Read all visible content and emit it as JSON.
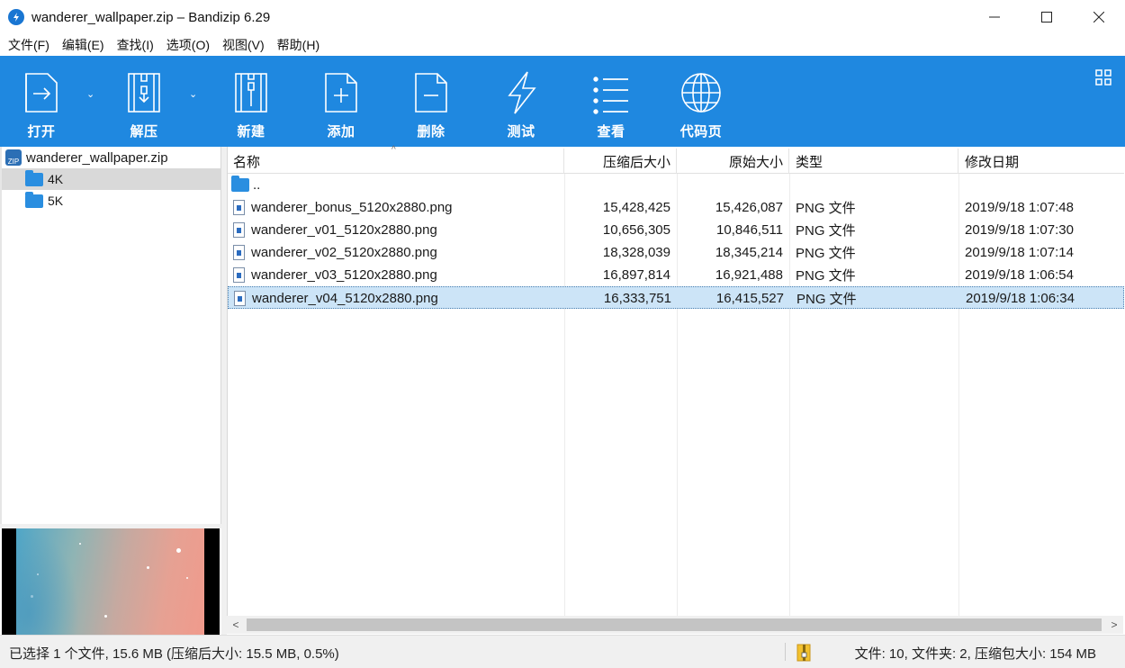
{
  "window": {
    "title": "wanderer_wallpaper.zip – Bandizip 6.29",
    "minimize_icon": "minimize-icon",
    "maximize_icon": "maximize-icon",
    "close_icon": "close-icon"
  },
  "menu": [
    "文件(F)",
    "编辑(E)",
    "查找(I)",
    "选项(O)",
    "视图(V)",
    "帮助(H)"
  ],
  "toolbar": {
    "accent": "#1f88e0",
    "buttons": [
      {
        "label": "打开",
        "icon": "open-icon"
      },
      {
        "label": "解压",
        "icon": "extract-icon"
      },
      {
        "label": "新建",
        "icon": "new-archive-icon"
      },
      {
        "label": "添加",
        "icon": "add-icon"
      },
      {
        "label": "删除",
        "icon": "delete-icon"
      },
      {
        "label": "测试",
        "icon": "test-icon"
      },
      {
        "label": "查看",
        "icon": "view-icon"
      },
      {
        "label": "代码页",
        "icon": "codepage-icon"
      }
    ]
  },
  "tree": {
    "root": "wanderer_wallpaper.zip",
    "zip_badge": "ZIP",
    "folders": [
      "4K",
      "5K"
    ],
    "selected": "4K"
  },
  "list": {
    "columns": [
      "名称",
      "压缩后大小",
      "原始大小",
      "类型",
      "修改日期"
    ],
    "sort_arrow": "^",
    "up_row": "..",
    "rows": [
      {
        "name": "wanderer_bonus_5120x2880.png",
        "packed": "15,428,425",
        "size": "15,426,087",
        "type": "PNG 文件",
        "modified": "2019/9/18 1:07:48"
      },
      {
        "name": "wanderer_v01_5120x2880.png",
        "packed": "10,656,305",
        "size": "10,846,511",
        "type": "PNG 文件",
        "modified": "2019/9/18 1:07:30"
      },
      {
        "name": "wanderer_v02_5120x2880.png",
        "packed": "18,328,039",
        "size": "18,345,214",
        "type": "PNG 文件",
        "modified": "2019/9/18 1:07:14"
      },
      {
        "name": "wanderer_v03_5120x2880.png",
        "packed": "16,897,814",
        "size": "16,921,488",
        "type": "PNG 文件",
        "modified": "2019/9/18 1:06:54"
      },
      {
        "name": "wanderer_v04_5120x2880.png",
        "packed": "16,333,751",
        "size": "16,415,527",
        "type": "PNG 文件",
        "modified": "2019/9/18 1:06:34"
      }
    ],
    "selected_index": 4
  },
  "status": {
    "left": "已选择 1 个文件, 15.6 MB (压缩后大小: 15.5 MB, 0.5%)",
    "right": "文件: 10, 文件夹: 2, 压缩包大小: 154 MB"
  }
}
